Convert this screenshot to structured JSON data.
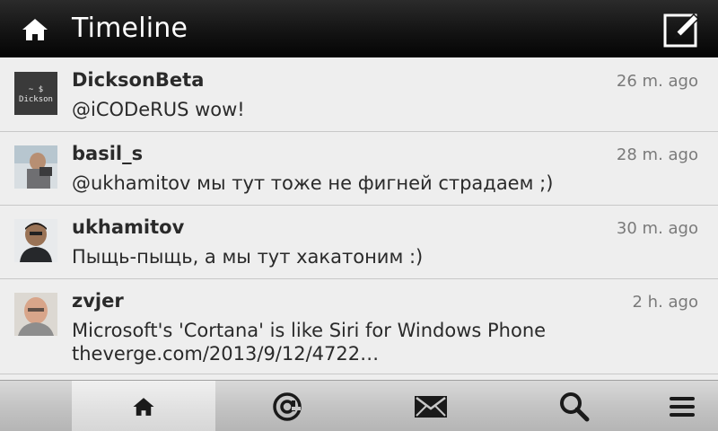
{
  "header": {
    "title": "Timeline",
    "home_icon": "home-icon",
    "compose_icon": "compose-icon"
  },
  "tweets": [
    {
      "author": "DicksonBeta",
      "time": "26 m. ago",
      "text": [
        "@iCODeRUS wow!"
      ],
      "avatar_text": [
        "~ $",
        "Dickson"
      ]
    },
    {
      "author": "basil_s",
      "time": "28 m. ago",
      "text": [
        "@ukhamitov мы тут тоже не фигней страдаем ;)"
      ]
    },
    {
      "author": "ukhamitov",
      "time": "30 m. ago",
      "text": [
        "Пыщь-пыщь, а мы тут хакатоним :)"
      ]
    },
    {
      "author": "zvjer",
      "time": "2 h. ago",
      "text": [
        "Microsoft's 'Cortana' is like Siri for Windows Phone",
        "theverge.com/2013/9/12/4722…"
      ]
    }
  ],
  "tabs": [
    {
      "name": "home",
      "icon": "home-icon",
      "active": true
    },
    {
      "name": "mentions",
      "icon": "at-icon",
      "active": false
    },
    {
      "name": "messages",
      "icon": "envelope-icon",
      "active": false
    },
    {
      "name": "search",
      "icon": "search-icon",
      "active": false
    },
    {
      "name": "menu",
      "icon": "menu-icon",
      "active": false
    }
  ],
  "colors": {
    "header_bg": "#141414",
    "list_bg": "#eeeeee",
    "text": "#2a2a2a",
    "time": "#7a7a7a",
    "tabbar_bg": "#c4c4c4"
  }
}
